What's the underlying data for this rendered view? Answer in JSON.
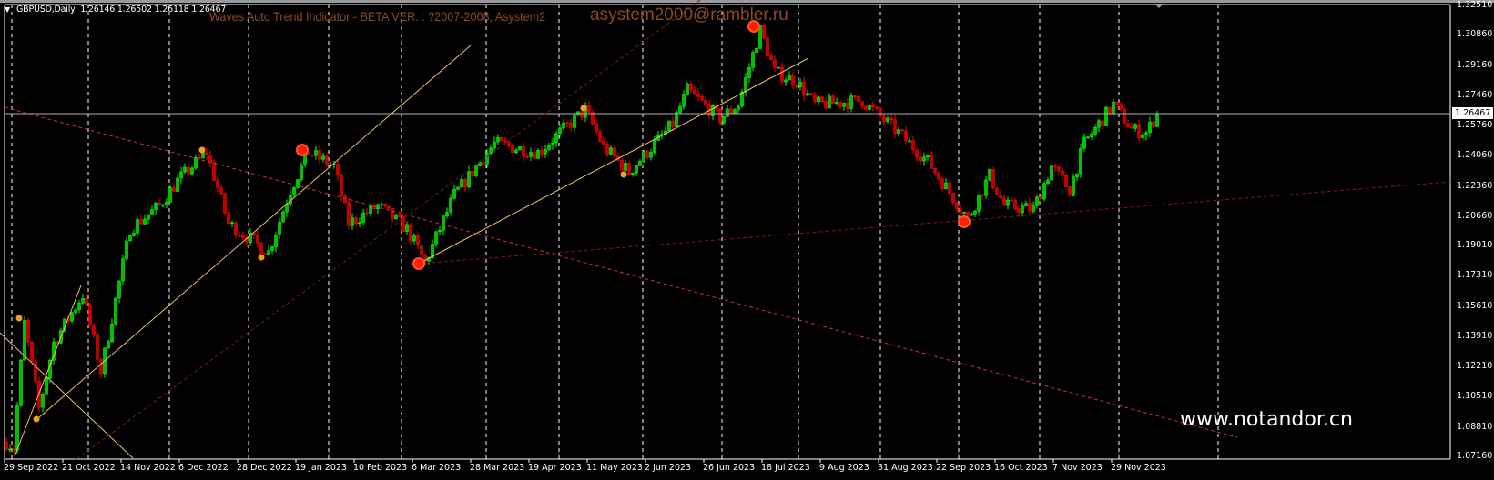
{
  "header": {
    "symbol_timeframe": "GBPUSD,Daily",
    "ohlc": "1.26146 1.26502 1.26118 1.26467"
  },
  "indicator": {
    "title": "Waves Auto Trend Indicator - BETA VER. : ?2007-2008, Asystem2",
    "email": "asystem2000@rambler.ru"
  },
  "watermark": "www.notandor.cn",
  "current_price": "1.26467",
  "colors": {
    "bull": "#00ff00",
    "bear": "#ff0000",
    "trend": "#f0c070",
    "channel": "#c03030",
    "grid": "#ffffff"
  },
  "chart_data": {
    "type": "candlestick",
    "title": "GBPUSD,Daily",
    "ylim": [
      1.0716,
      1.3251
    ],
    "y_ticks": [
      "1.32510",
      "1.30860",
      "1.29160",
      "1.27460",
      "1.25760",
      "1.24060",
      "1.22360",
      "1.20660",
      "1.19010",
      "1.17310",
      "1.15610",
      "1.13910",
      "1.12210",
      "1.10510",
      "1.08810",
      "1.07160"
    ],
    "x_ticks": [
      "29 Sep 2022",
      "21 Oct 2022",
      "14 Nov 2022",
      "6 Dec 2022",
      "28 Dec 2022",
      "19 Jan 2023",
      "10 Feb 2023",
      "6 Mar 2023",
      "28 Mar 2023",
      "19 Apr 2023",
      "11 May 2023",
      "2 Jun 2023",
      "26 Jun 2023",
      "18 Jul 2023",
      "9 Aug 2023",
      "31 Aug 2023",
      "22 Sep 2023",
      "16 Oct 2023",
      "7 Nov 2023",
      "29 Nov 2023"
    ],
    "bars_per_tick": 16,
    "close_path": [
      [
        0,
        1.08
      ],
      [
        2,
        1.077
      ],
      [
        5,
        1.147
      ],
      [
        9,
        1.099
      ],
      [
        13,
        1.136
      ],
      [
        21,
        1.163
      ],
      [
        26,
        1.12
      ],
      [
        34,
        1.2
      ],
      [
        42,
        1.213
      ],
      [
        47,
        1.227
      ],
      [
        55,
        1.243
      ],
      [
        61,
        1.203
      ],
      [
        72,
        1.187
      ],
      [
        78,
        1.222
      ],
      [
        83,
        1.243
      ],
      [
        90,
        1.235
      ],
      [
        94,
        1.203
      ],
      [
        102,
        1.213
      ],
      [
        110,
        1.2
      ],
      [
        115,
        1.181
      ],
      [
        123,
        1.219
      ],
      [
        134,
        1.248
      ],
      [
        146,
        1.243
      ],
      [
        159,
        1.267
      ],
      [
        164,
        1.246
      ],
      [
        171,
        1.232
      ],
      [
        183,
        1.259
      ],
      [
        187,
        1.278
      ],
      [
        196,
        1.262
      ],
      [
        201,
        1.27
      ],
      [
        207,
        1.312
      ],
      [
        211,
        1.288
      ],
      [
        217,
        1.283
      ],
      [
        222,
        1.27
      ],
      [
        235,
        1.272
      ],
      [
        245,
        1.254
      ],
      [
        253,
        1.238
      ],
      [
        264,
        1.206
      ],
      [
        270,
        1.23
      ],
      [
        274,
        1.213
      ],
      [
        282,
        1.211
      ],
      [
        287,
        1.235
      ],
      [
        292,
        1.222
      ],
      [
        296,
        1.248
      ],
      [
        304,
        1.27
      ],
      [
        309,
        1.256
      ],
      [
        313,
        1.254
      ],
      [
        316,
        1.26467
      ]
    ]
  }
}
